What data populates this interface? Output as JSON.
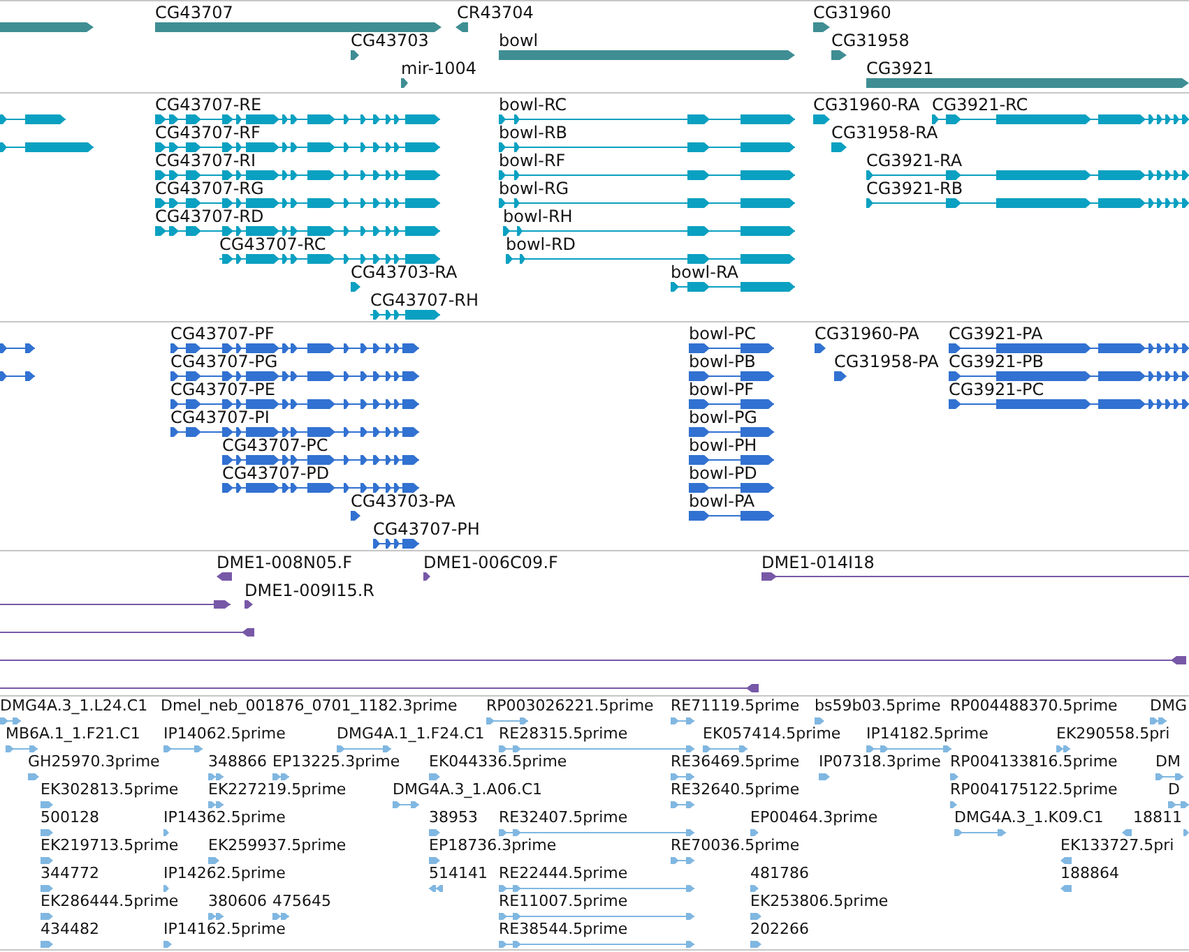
{
  "tracks": [
    {
      "kind": "gene",
      "features": [
        {
          "reverse": false
        },
        {
          "label": "CG43707",
          "reverse": false
        },
        {
          "label": "CR43704",
          "reverse": true
        },
        {
          "label": "CG31960",
          "reverse": false
        },
        {
          "label": "CG43703",
          "reverse": false
        },
        {
          "label": "bowl",
          "reverse": false
        },
        {
          "label": "CG31958",
          "reverse": false
        },
        {
          "label": "mir-1004",
          "reverse": false
        },
        {
          "label": "CG3921",
          "reverse": false
        }
      ]
    },
    {
      "kind": "transcript",
      "features": [
        {
          "reverse": false
        },
        {
          "label": "CG43707-RE",
          "reverse": false
        },
        {
          "label": "bowl-RC",
          "reverse": false
        },
        {
          "label": "CG31960-RA",
          "reverse": false
        },
        {
          "label": "CG3921-RC",
          "reverse": false
        },
        {
          "reverse": false
        },
        {
          "label": "CG43707-RF",
          "reverse": false
        },
        {
          "label": "bowl-RB",
          "reverse": false
        },
        {
          "label": "CG31958-RA",
          "reverse": false
        },
        {
          "label": "CG43707-RI",
          "reverse": false
        },
        {
          "label": "bowl-RF",
          "reverse": false
        },
        {
          "label": "CG3921-RA",
          "reverse": false
        },
        {
          "label": "CG43707-RG",
          "reverse": false
        },
        {
          "label": "bowl-RG",
          "reverse": false
        },
        {
          "label": "CG3921-RB",
          "reverse": false
        },
        {
          "label": "CG43707-RD",
          "reverse": false
        },
        {
          "label": "bowl-RH",
          "reverse": false
        },
        {
          "label": "CG43707-RC",
          "reverse": false
        },
        {
          "label": "bowl-RD",
          "reverse": false
        },
        {
          "label": "CG43703-RA",
          "reverse": false
        },
        {
          "label": "bowl-RA",
          "reverse": false
        },
        {
          "label": "CG43707-RH",
          "reverse": false
        }
      ]
    },
    {
      "kind": "protein",
      "features": [
        {
          "reverse": false
        },
        {
          "label": "CG43707-PF",
          "reverse": false
        },
        {
          "label": "bowl-PC",
          "reverse": false
        },
        {
          "label": "CG31960-PA",
          "reverse": false
        },
        {
          "label": "CG3921-PA",
          "reverse": false
        },
        {
          "reverse": false
        },
        {
          "label": "CG43707-PG",
          "reverse": false
        },
        {
          "label": "bowl-PB",
          "reverse": false
        },
        {
          "label": "CG31958-PA",
          "reverse": false
        },
        {
          "label": "CG3921-PB",
          "reverse": false
        },
        {
          "label": "CG43707-PE",
          "reverse": false
        },
        {
          "label": "bowl-PF",
          "reverse": false
        },
        {
          "label": "CG3921-PC",
          "reverse": false
        },
        {
          "label": "CG43707-PI",
          "reverse": false
        },
        {
          "label": "bowl-PG",
          "reverse": false
        },
        {
          "label": "CG43707-PC",
          "reverse": false
        },
        {
          "label": "bowl-PH",
          "reverse": false
        },
        {
          "label": "CG43707-PD",
          "reverse": false
        },
        {
          "label": "bowl-PD",
          "reverse": false
        },
        {
          "label": "CG43703-PA",
          "reverse": false
        },
        {
          "label": "bowl-PA",
          "reverse": false
        },
        {
          "label": "CG43707-PH",
          "reverse": false
        }
      ]
    },
    {
      "kind": "clone",
      "features": [
        {
          "label": "DME1-008N05.F",
          "reverse": true
        },
        {
          "label": "DME1-006C09.F",
          "reverse": false
        },
        {
          "label": "DME1-014I18",
          "reverse": false
        },
        {
          "reverse": false
        },
        {
          "label": "DME1-009I15.R",
          "reverse": false
        },
        {
          "reverse": true
        },
        {
          "reverse": true
        },
        {
          "reverse": true
        }
      ]
    },
    {
      "kind": "est",
      "features": [
        {
          "label": "DMG4A.3_1.L24.C1",
          "reverse": false
        },
        {
          "label": "Dmel_neb_001876_0701_1182.3prime"
        },
        {
          "label": "RP003026221.5prime",
          "reverse": false
        },
        {
          "label": "RE71119.5prime",
          "reverse": false
        },
        {
          "label": "bs59b03.5prime",
          "reverse": false
        },
        {
          "label": "RP004488370.5prime"
        },
        {
          "label": "DMG",
          "reverse": false
        },
        {
          "label": "MB6A.1_1.F21.C1",
          "reverse": false
        },
        {
          "label": "IP14062.5prime",
          "reverse": false
        },
        {
          "label": "DMG4A.1_1.F24.C1",
          "reverse": false
        },
        {
          "label": "RE28315.5prime",
          "reverse": false
        },
        {
          "label": "EK057414.5prime",
          "reverse": false
        },
        {
          "label": "IP14182.5prime",
          "reverse": false
        },
        {
          "label": "EK290558.5pri",
          "reverse": false
        },
        {
          "label": "GH25970.3prime",
          "reverse": false
        },
        {
          "label": "348866",
          "reverse": false
        },
        {
          "label": "EP13225.3prime",
          "reverse": false
        },
        {
          "label": "EK044336.5prime",
          "reverse": false
        },
        {
          "label": "RE36469.5prime",
          "reverse": false
        },
        {
          "label": "IP07318.3prime",
          "reverse": false
        },
        {
          "label": "RP004133816.5prime",
          "reverse": false
        },
        {
          "label": "DM",
          "reverse": false
        },
        {
          "label": "EK302813.5prime",
          "reverse": false
        },
        {
          "label": "EK227219.5prime",
          "reverse": false
        },
        {
          "label": "DMG4A.3_1.A06.C1",
          "reverse": false
        },
        {
          "label": "RE32640.5prime",
          "reverse": false
        },
        {
          "label": "RP004175122.5prime",
          "reverse": false
        },
        {
          "label": "D",
          "reverse": false
        },
        {
          "label": "500128",
          "reverse": false
        },
        {
          "label": "IP14362.5prime",
          "reverse": false
        },
        {
          "label": "38953",
          "reverse": false
        },
        {
          "label": "RE32407.5prime",
          "reverse": false
        },
        {
          "label": "EP00464.3prime",
          "reverse": false
        },
        {
          "label": "DMG4A.3_1.K09.C1",
          "reverse": false
        },
        {
          "label": "18811",
          "reverse": true
        },
        {
          "reverse": false
        },
        {
          "label": "EK219713.5prime",
          "reverse": false
        },
        {
          "label": "EK259937.5prime",
          "reverse": false
        },
        {
          "label": "EP18736.3prime",
          "reverse": false
        },
        {
          "label": "RE70036.5prime",
          "reverse": false
        },
        {
          "label": "EK133727.5pri",
          "reverse": true
        },
        {
          "label": "344772",
          "reverse": false
        },
        {
          "label": "IP14262.5prime",
          "reverse": false
        },
        {
          "label": "514141",
          "reverse": true
        },
        {
          "label": "RE22444.5prime",
          "reverse": false
        },
        {
          "label": "481786",
          "reverse": false
        },
        {
          "label": "188864",
          "reverse": true
        },
        {
          "label": "EK286444.5prime",
          "reverse": false
        },
        {
          "label": "380606",
          "reverse": false
        },
        {
          "label": "475645",
          "reverse": false
        },
        {
          "label": "RE11007.5prime",
          "reverse": false
        },
        {
          "label": "EK253806.5prime",
          "reverse": false
        },
        {
          "label": "434482",
          "reverse": false
        },
        {
          "label": "IP14162.5prime",
          "reverse": false
        },
        {
          "label": "RE38544.5prime",
          "reverse": false
        },
        {
          "label": "202266",
          "reverse": false
        }
      ]
    }
  ]
}
